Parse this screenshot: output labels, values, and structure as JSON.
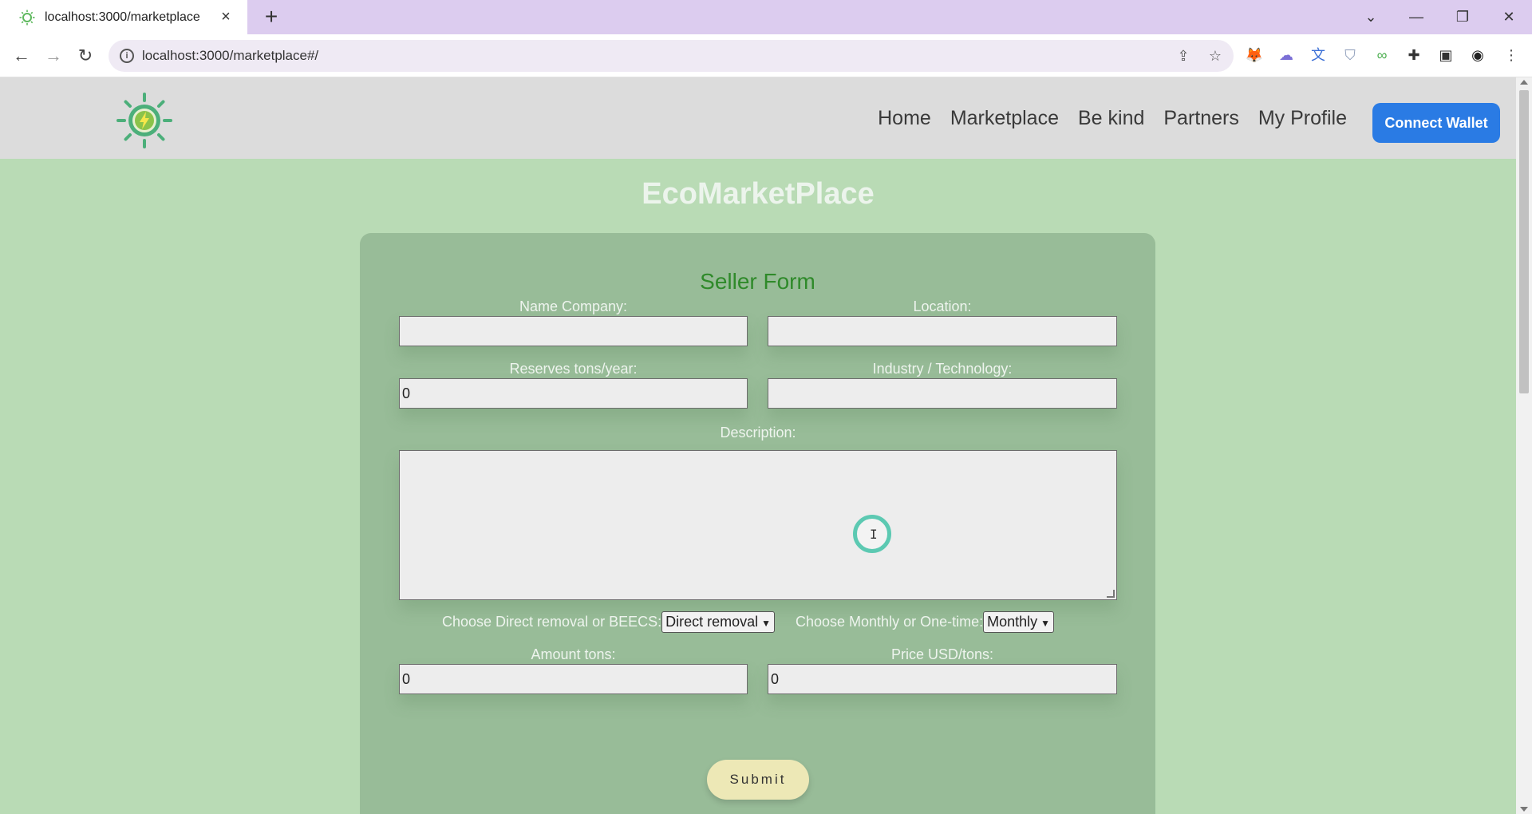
{
  "browser": {
    "tab_title": "localhost:3000/marketplace",
    "url": "localhost:3000/marketplace#/",
    "new_tab_symbol": "+",
    "tab_close_symbol": "×",
    "icons": [
      "back-icon",
      "forward-icon",
      "reload-icon",
      "info-icon",
      "share-icon",
      "star-icon",
      "metamask-icon",
      "extension-icon",
      "translate-icon",
      "shield-icon",
      "puzzle-icon",
      "sidepanel-icon",
      "profile-icon",
      "menu-icon"
    ]
  },
  "header": {
    "nav": [
      "Home",
      "Marketplace",
      "Be kind",
      "Partners",
      "My Profile"
    ],
    "connect_label": "Connect Wallet"
  },
  "page": {
    "title": "EcoMarketPlace"
  },
  "form": {
    "title": "Seller Form",
    "name_company_label": "Name Company:",
    "name_company_value": "",
    "location_label": "Location:",
    "location_value": "",
    "reserves_label": "Reserves tons/year:",
    "reserves_value": "0",
    "industry_label": "Industry / Technology:",
    "industry_value": "",
    "description_label": "Description:",
    "description_value": "",
    "removal_label": "Choose Direct removal or BEECS:",
    "removal_selected": "Direct removal",
    "frequency_label": "Choose Monthly or One-time:",
    "frequency_selected": "Monthly",
    "amount_label": "Amount tons:",
    "amount_value": "0",
    "price_label": "Price USD/tons:",
    "price_value": "0",
    "submit_label": "Submit"
  },
  "colors": {
    "page_bg": "#b9dbb5",
    "card_bg": "#98bc98",
    "title_green": "#2f8a2a",
    "button_blue": "#2a7be4",
    "submit_bg": "#ede8b6"
  }
}
